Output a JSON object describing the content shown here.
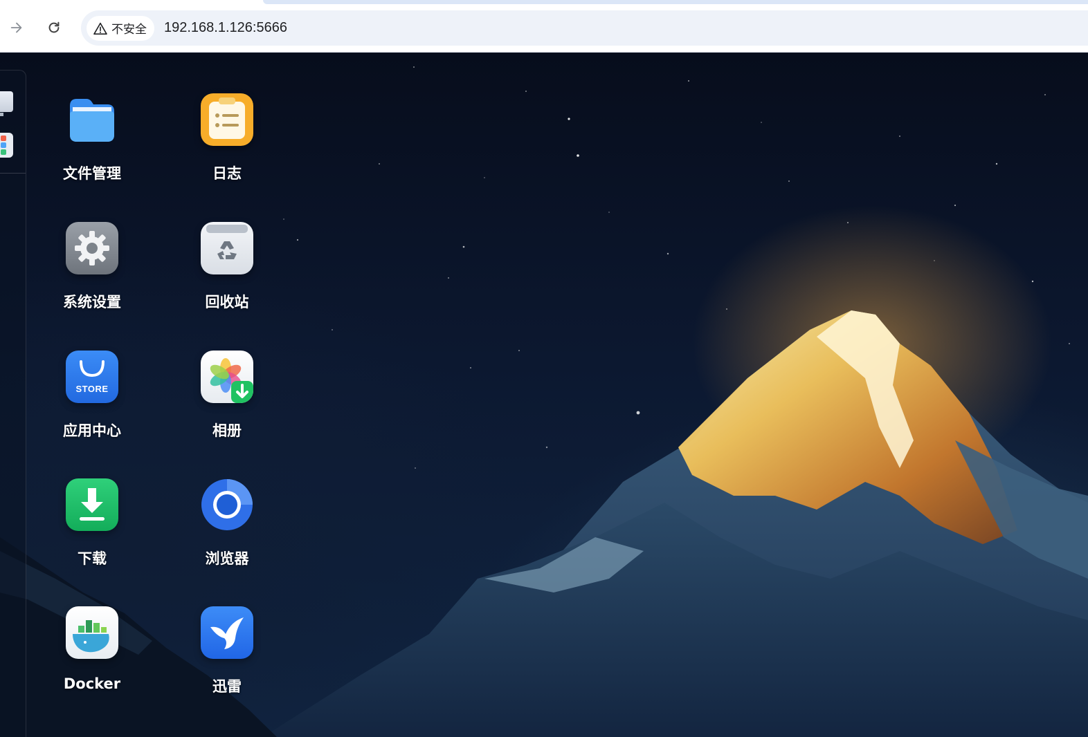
{
  "browser": {
    "back_icon": "arrow-right-icon",
    "reload_icon": "reload-icon",
    "security_label": "不安全",
    "url": "192.168.1.126:5666"
  },
  "desktop": {
    "apps": [
      {
        "label": "文件管理",
        "icon": "folder-icon"
      },
      {
        "label": "日志",
        "icon": "log-icon"
      },
      {
        "label": "系统设置",
        "icon": "gear-icon"
      },
      {
        "label": "回收站",
        "icon": "recycle-bin-icon"
      },
      {
        "label": "应用中心",
        "icon": "store-icon",
        "icon_text": "STORE"
      },
      {
        "label": "相册",
        "icon": "photos-icon"
      },
      {
        "label": "下载",
        "icon": "download-icon"
      },
      {
        "label": "浏览器",
        "icon": "browser-icon"
      },
      {
        "label": "Docker",
        "icon": "docker-icon"
      },
      {
        "label": "迅雷",
        "icon": "thunder-bird-icon"
      }
    ]
  },
  "colors": {
    "folder": "#4da3f5",
    "log": "#f7b02b",
    "settings": "#8a9099",
    "store": "#2f7ff0",
    "download": "#1fc46b",
    "browser": "#2f6fe8",
    "thunder": "#2f7ff0"
  }
}
